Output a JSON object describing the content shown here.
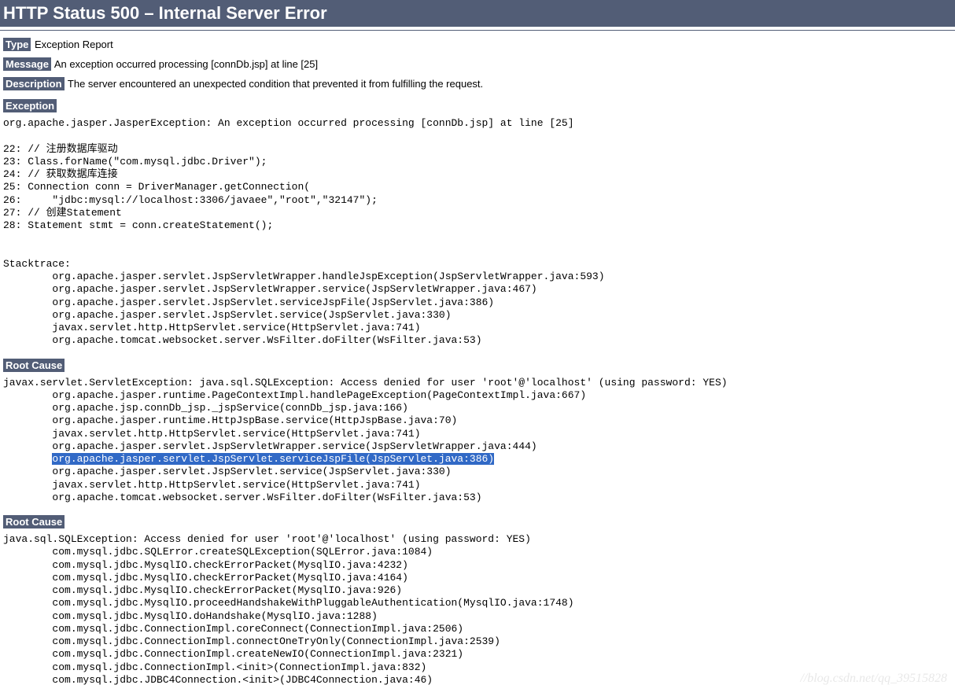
{
  "header": {
    "title": "HTTP Status 500 – Internal Server Error"
  },
  "fields": {
    "type_label": "Type",
    "type_value": " Exception Report",
    "message_label": "Message",
    "message_value": " An exception occurred processing [connDb.jsp] at line [25]",
    "description_label": "Description",
    "description_value": " The server encountered an unexpected condition that prevented it from fulfilling the request."
  },
  "sections": {
    "exception": {
      "label": "Exception",
      "text": "org.apache.jasper.JasperException: An exception occurred processing [connDb.jsp] at line [25]\n\n22: // 注册数据库驱动\n23: Class.forName(\"com.mysql.jdbc.Driver\");\n24: // 获取数据库连接\n25: Connection conn = DriverManager.getConnection(\n26:     \"jdbc:mysql://localhost:3306/javaee\",\"root\",\"32147\");\n27: // 创建Statement\n28: Statement stmt = conn.createStatement();\n\n\nStacktrace:\n\torg.apache.jasper.servlet.JspServletWrapper.handleJspException(JspServletWrapper.java:593)\n\torg.apache.jasper.servlet.JspServletWrapper.service(JspServletWrapper.java:467)\n\torg.apache.jasper.servlet.JspServlet.serviceJspFile(JspServlet.java:386)\n\torg.apache.jasper.servlet.JspServlet.service(JspServlet.java:330)\n\tjavax.servlet.http.HttpServlet.service(HttpServlet.java:741)\n\torg.apache.tomcat.websocket.server.WsFilter.doFilter(WsFilter.java:53)"
    },
    "rootcause1": {
      "label": "Root Cause",
      "pre_text": "javax.servlet.ServletException: java.sql.SQLException: Access denied for user 'root'@'localhost' (using password: YES)\n\torg.apache.jasper.runtime.PageContextImpl.handlePageException(PageContextImpl.java:667)\n\torg.apache.jsp.connDb_jsp._jspService(connDb_jsp.java:166)\n\torg.apache.jasper.runtime.HttpJspBase.service(HttpJspBase.java:70)\n\tjavax.servlet.http.HttpServlet.service(HttpServlet.java:741)\n\torg.apache.jasper.servlet.JspServletWrapper.service(JspServletWrapper.java:444)\n\t",
      "highlighted_text": "org.apache.jasper.servlet.JspServlet.serviceJspFile(JspServlet.java:386)",
      "post_text": "\n\torg.apache.jasper.servlet.JspServlet.service(JspServlet.java:330)\n\tjavax.servlet.http.HttpServlet.service(HttpServlet.java:741)\n\torg.apache.tomcat.websocket.server.WsFilter.doFilter(WsFilter.java:53)"
    },
    "rootcause2": {
      "label": "Root Cause",
      "text": "java.sql.SQLException: Access denied for user 'root'@'localhost' (using password: YES)\n\tcom.mysql.jdbc.SQLError.createSQLException(SQLError.java:1084)\n\tcom.mysql.jdbc.MysqlIO.checkErrorPacket(MysqlIO.java:4232)\n\tcom.mysql.jdbc.MysqlIO.checkErrorPacket(MysqlIO.java:4164)\n\tcom.mysql.jdbc.MysqlIO.checkErrorPacket(MysqlIO.java:926)\n\tcom.mysql.jdbc.MysqlIO.proceedHandshakeWithPluggableAuthentication(MysqlIO.java:1748)\n\tcom.mysql.jdbc.MysqlIO.doHandshake(MysqlIO.java:1288)\n\tcom.mysql.jdbc.ConnectionImpl.coreConnect(ConnectionImpl.java:2506)\n\tcom.mysql.jdbc.ConnectionImpl.connectOneTryOnly(ConnectionImpl.java:2539)\n\tcom.mysql.jdbc.ConnectionImpl.createNewIO(ConnectionImpl.java:2321)\n\tcom.mysql.jdbc.ConnectionImpl.<init>(ConnectionImpl.java:832)\n\tcom.mysql.jdbc.JDBC4Connection.<init>(JDBC4Connection.java:46)"
    }
  },
  "watermark": "//blog.csdn.net/qq_39515828"
}
